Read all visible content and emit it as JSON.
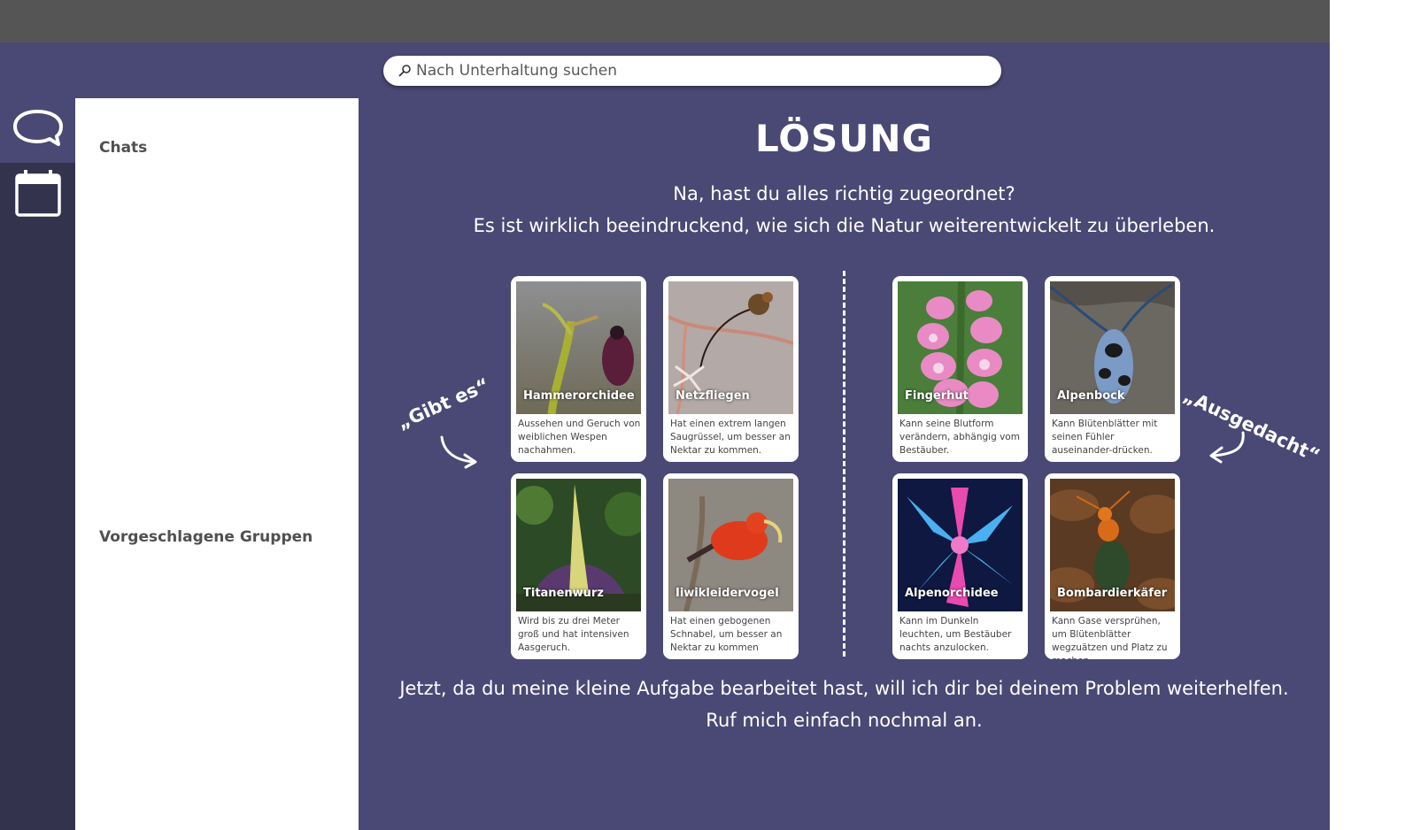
{
  "search": {
    "placeholder": "Nach Unterhaltung suchen",
    "icon": "search-icon"
  },
  "rail": {
    "items": [
      {
        "icon": "chat-bubble-icon"
      },
      {
        "icon": "calendar-icon"
      }
    ]
  },
  "sidebar": {
    "chats_heading": "Chats",
    "groups_heading": "Vorgeschlagene Gruppen"
  },
  "solution": {
    "title": "LÖSUNG",
    "intro_line1": "Na, hast du alles richtig zugeordnet?",
    "intro_line2": "Es ist wirklich beeindruckend, wie sich die Natur weiterentwickelt zu überleben.",
    "label_left": "„Gibt es“",
    "label_right": "„Ausgedacht“",
    "outro_line1": "Jetzt, da du meine kleine Aufgabe bearbeitet hast, will ich dir bei deinem Problem weiterhelfen.",
    "outro_line2": "Ruf mich einfach nochmal an."
  },
  "cards_real": [
    {
      "name": "Hammerorchidee",
      "desc": "Aussehen und Geruch von weiblichen Wespen nachahmen."
    },
    {
      "name": "Netzfliegen",
      "desc": "Hat einen extrem langen Saugrüssel, um besser an Nektar zu kommen."
    },
    {
      "name": "Titanenwurz",
      "desc": "Wird bis zu drei Meter groß und hat intensiven Aasgeruch."
    },
    {
      "name": "Iiwikleidervogel",
      "desc": "Hat einen gebogenen Schnabel, um besser an Nektar zu kommen"
    }
  ],
  "cards_fake": [
    {
      "name": "Fingerhut",
      "desc": "Kann seine Blutform verändern, abhängig vom Bestäuber."
    },
    {
      "name": "Alpenbock",
      "desc": "Kann Blütenblätter mit seinen Fühler auseinander-drücken."
    },
    {
      "name": "Alpenorchidee",
      "desc": "Kann im Dunkeln leuchten, um Bestäuber nachts anzulocken."
    },
    {
      "name": "Bombardierkäfer",
      "desc": "Kann Gase versprühen, um Blütenblätter wegzuätzen und Platz zu machen."
    }
  ]
}
